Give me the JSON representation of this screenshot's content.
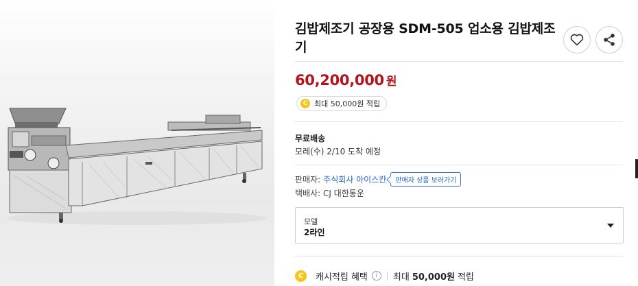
{
  "product": {
    "title": "김밥제조기 공장용 SDM-505 업소용 김밥제조기",
    "image_alt": "SDM-505 김밥제조기 제품 사진"
  },
  "actions": {
    "like_icon": "heart-icon",
    "share_icon": "share-icon"
  },
  "price": {
    "amount": "60,200,000",
    "unit": "원",
    "color": "#b3141c"
  },
  "points_chip": {
    "coin_symbol": "C",
    "text": "최대 50,000원 적립"
  },
  "shipping": {
    "title": "무료배송",
    "date": "모레(수) 2/10 도착 예정"
  },
  "seller": {
    "label": "판매자:",
    "name": "주식회사 아이스칸",
    "button": "판매자 상품 보러가기"
  },
  "courier": {
    "text": "택배사: CJ 대한통운"
  },
  "option": {
    "label": "모델",
    "value": "2라인"
  },
  "cashback": {
    "coin_symbol": "C",
    "label": "캐시적립 혜택",
    "info_symbol": "i",
    "prefix": "최대",
    "amount": "50,000원",
    "suffix": "적립"
  },
  "colors": {
    "accent_blue": "#2a64c8",
    "coin_yellow": "#f6c51b"
  }
}
